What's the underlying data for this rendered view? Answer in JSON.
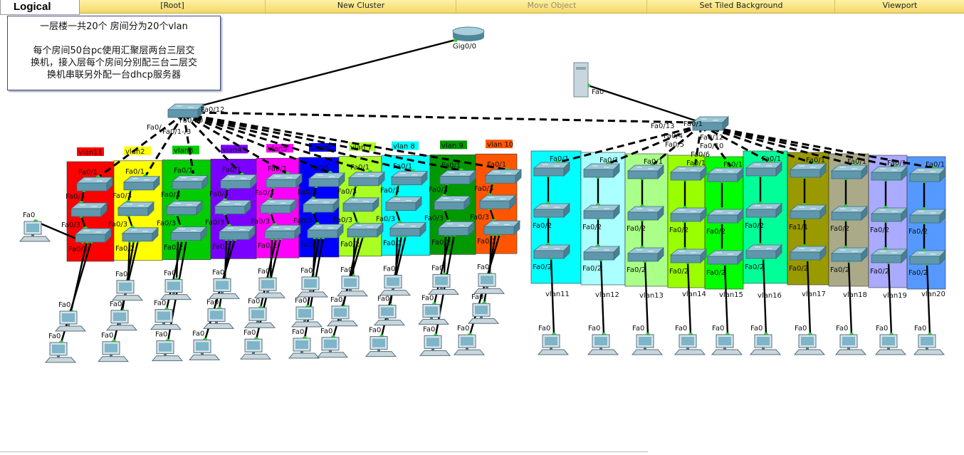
{
  "toolbar": {
    "logical": "Logical",
    "root": "[Root]",
    "new_cluster": "New Cluster",
    "move_object": "Move Object",
    "set_tiled_background": "Set Tiled Background",
    "viewport": "Viewport"
  },
  "note": {
    "line1": "一层楼一共20个 房间分为20个vlan",
    "line2": "每个房间50台pc使用汇聚层两台三层交",
    "line3": "换机，接入层每个房间分别配三台二层交",
    "line4": "换机串联另外配一台dhcp服务器"
  },
  "top_devices": {
    "router_port": "Gig0/0",
    "server_port": "Fa0",
    "left_core_ports": [
      "Fa0/12",
      "Fa0/10",
      "Fa0/1-/3",
      "Fa0/"
    ],
    "right_core_ports": [
      "Fa0/13",
      "Fa0/1",
      "Fa0/12",
      "Fa0/10",
      "Fa0/4",
      "Fa0/5",
      "Fa0/6"
    ]
  },
  "left_rooms": [
    {
      "vlan": "vlan11",
      "color": "#ff0000"
    },
    {
      "vlan": "vlan2",
      "color": "#ffff00"
    },
    {
      "vlan": "vlan3",
      "color": "#00cc00"
    },
    {
      "vlan": "vlan4",
      "color": "#7a00ff"
    },
    {
      "vlan": "vlan5",
      "color": "#ff00ff"
    },
    {
      "vlan": "vlan6",
      "color": "#0000ff"
    },
    {
      "vlan": "vlan 7",
      "color": "#aaff22"
    },
    {
      "vlan": "vlan 8",
      "color": "#00ffff"
    },
    {
      "vlan": "vlan 9",
      "color": "#009900"
    },
    {
      "vlan": "vlan 10",
      "color": "#ff5500"
    }
  ],
  "right_rooms": [
    {
      "vlan": "vlan11",
      "color": "#00ffff"
    },
    {
      "vlan": "vlan12",
      "color": "#aaffff"
    },
    {
      "vlan": "vlan13",
      "color": "#aaff88"
    },
    {
      "vlan": "vlan14",
      "color": "#99ff00"
    },
    {
      "vlan": "vlan15",
      "color": "#00ff00"
    },
    {
      "vlan": "vlan16",
      "color": "#00ff99"
    },
    {
      "vlan": "vlan17",
      "color": "#999900"
    },
    {
      "vlan": "vlan18",
      "color": "#aaaa88"
    },
    {
      "vlan": "vlan19",
      "color": "#aaaaff"
    },
    {
      "vlan": "vlan20",
      "color": "#5599ff"
    }
  ],
  "switch_ports": {
    "uplink": "Fa0/1",
    "mid": "Fa0/3",
    "down": "Fa0/2",
    "pc": "Fa0",
    "alt": "Fa1/1"
  }
}
